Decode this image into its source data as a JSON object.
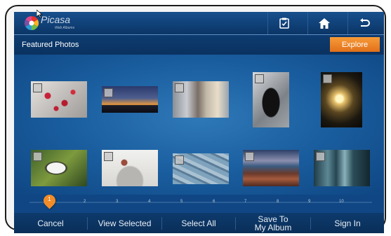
{
  "app": {
    "name": "Picasa",
    "subtitle": "Web Albums"
  },
  "header": {
    "buttons": [
      "clipboard-icon",
      "home-icon",
      "back-arrow-icon"
    ]
  },
  "section": {
    "title": "Featured Photos",
    "explore_label": "Explore"
  },
  "photos": [
    {
      "subject": "red berries on snowy branches",
      "checked": false
    },
    {
      "subject": "city skyline at sunset",
      "checked": false
    },
    {
      "subject": "busy city street",
      "checked": false
    },
    {
      "subject": "penguin on rocks",
      "checked": false
    },
    {
      "subject": "street lamp at night",
      "checked": false
    },
    {
      "subject": "panda eating bamboo",
      "checked": false
    },
    {
      "subject": "floating red object",
      "checked": false
    },
    {
      "subject": "birds on blue pattern",
      "checked": false
    },
    {
      "subject": "rocky coastline",
      "checked": false
    },
    {
      "subject": "forest with light rays",
      "checked": false
    }
  ],
  "timeline": {
    "current": "1",
    "labels": [
      "2",
      "3",
      "4",
      "5",
      "6",
      "7",
      "8",
      "9",
      "10"
    ]
  },
  "bottombar": {
    "cancel": "Cancel",
    "view_selected": "View Selected",
    "select_all": "Select All",
    "save_line1": "Save To",
    "save_line2": "My Album",
    "sign_in": "Sign In"
  },
  "colors": {
    "accent": "#f28c28",
    "background": "#1a5e9f"
  }
}
